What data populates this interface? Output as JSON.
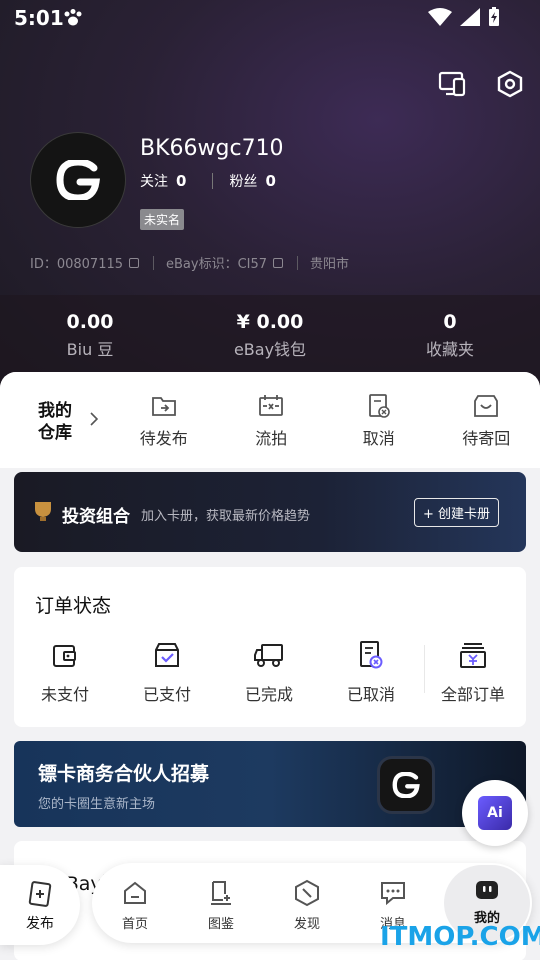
{
  "status_bar": {
    "time": "5:01"
  },
  "profile": {
    "username": "BK66wgc710",
    "follow_label": "关注",
    "follow_count": "0",
    "fans_label": "粉丝",
    "fans_count": "0",
    "badge": "未实名",
    "id_text": "ID：00807115",
    "ebay_id_text": "eBay标识：CI57",
    "location": "贵阳市"
  },
  "stats": [
    {
      "value": "0.00",
      "label": "Biu 豆"
    },
    {
      "value": "¥ 0.00",
      "label": "eBay钱包"
    },
    {
      "value": "0",
      "label": "收藏夹"
    }
  ],
  "warehouse": {
    "title": "我的仓库",
    "items": [
      {
        "label": "待发布",
        "icon": "upload-folder-icon"
      },
      {
        "label": "流拍",
        "icon": "auction-fail-icon"
      },
      {
        "label": "取消",
        "icon": "cancel-doc-icon"
      },
      {
        "label": "待寄回",
        "icon": "return-box-icon"
      }
    ]
  },
  "portfolio_banner": {
    "title": "投资组合",
    "subtitle": "加入卡册，获取最新价格趋势",
    "button": "+ 创建卡册"
  },
  "orders": {
    "title": "订单状态",
    "items": [
      {
        "label": "未支付",
        "icon": "wallet-icon"
      },
      {
        "label": "已支付",
        "icon": "paid-bag-icon"
      },
      {
        "label": "已完成",
        "icon": "truck-icon"
      },
      {
        "label": "已取消",
        "icon": "cancel-doc-icon"
      },
      {
        "label": "全部订单",
        "icon": "yuan-box-icon"
      }
    ]
  },
  "partner_banner": {
    "title": "镖卡商务合伙人招募",
    "subtitle": "您的卡圈生意新主场"
  },
  "services": {
    "title": "eBay服务"
  },
  "ai_button": {
    "label": "Ai"
  },
  "publish": {
    "label": "发布"
  },
  "tabs": [
    {
      "label": "首页",
      "icon": "home-icon"
    },
    {
      "label": "图鉴",
      "icon": "catalog-icon"
    },
    {
      "label": "发现",
      "icon": "discover-icon"
    },
    {
      "label": "消息",
      "icon": "message-icon"
    },
    {
      "label": "我的",
      "icon": "profile-icon"
    }
  ],
  "watermark": "ITMOP.COM",
  "colors": {
    "accent": "#6b5cff",
    "hero_bg": "#2a2135",
    "watermark": "#1aa3e8"
  }
}
